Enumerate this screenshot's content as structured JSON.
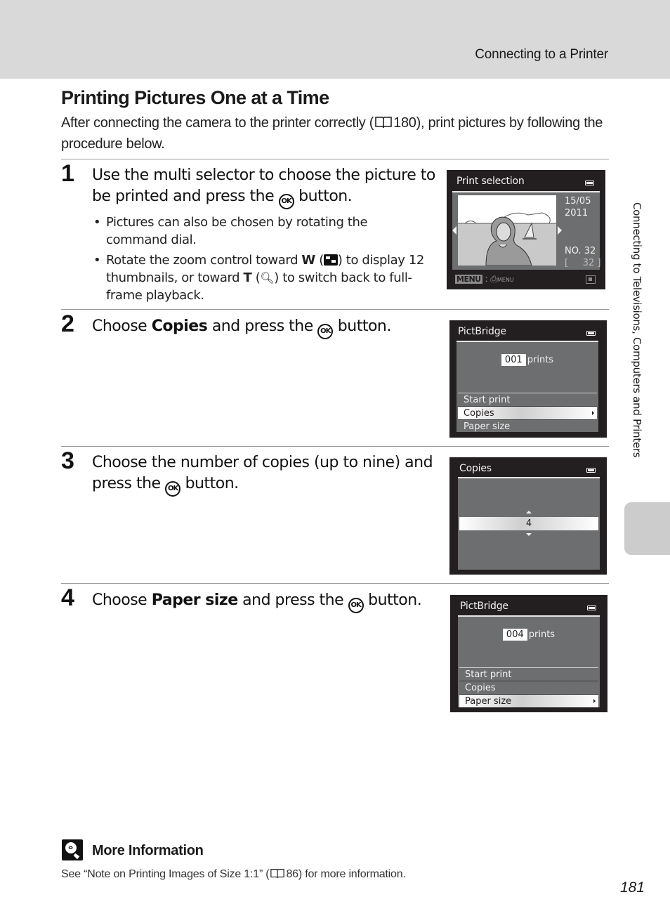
{
  "header": {
    "section_title": "Connecting to a Printer"
  },
  "page": {
    "title": "Printing Pictures One at a Time",
    "intro_before_ref": "After connecting the camera to the printer correctly (",
    "intro_ref": "180",
    "intro_after_ref": "), print pictures by following the procedure below.",
    "page_number": "181"
  },
  "icons": {
    "ok": "OK",
    "book": "book-icon",
    "zoom_w": "W",
    "zoom_t": "T"
  },
  "steps": [
    {
      "number": "1",
      "text_line": "Use the multi selector to choose the picture to be printed and press the",
      "text_end": "button.",
      "bullets": [
        {
          "text": "Pictures can also be chosen by rotating the command dial."
        },
        {
          "part1": "Rotate the zoom control toward",
          "w": "W",
          "part2": ") to display 12 thumbnails, or toward",
          "t": "T",
          "part3": ") to switch back to full-frame playback."
        }
      ],
      "screen": {
        "title": "Print selection",
        "date": "15/05",
        "year": "2011",
        "number": "NO. 32",
        "count": "[     32 ]",
        "footer_menu": "MENU",
        "footer_label": "MENU"
      }
    },
    {
      "number": "2",
      "pre": "Choose",
      "bold": "Copies",
      "post": "and press the",
      "end": "button.",
      "screen": {
        "title": "PictBridge",
        "prints_count": "001",
        "prints_label": "prints",
        "menu": [
          "Start print",
          "Copies",
          "Paper size"
        ],
        "selected_index": 1
      }
    },
    {
      "number": "3",
      "text": "Choose the number of copies (up to nine) and press the",
      "end": "button.",
      "screen": {
        "title": "Copies",
        "value": "4"
      }
    },
    {
      "number": "4",
      "pre": "Choose",
      "bold": "Paper size",
      "post": "and press the",
      "end": "button.",
      "screen": {
        "title": "PictBridge",
        "prints_count": "004",
        "prints_label": "prints",
        "menu": [
          "Start print",
          "Copies",
          "Paper size"
        ],
        "selected_index": 2
      }
    }
  ],
  "more_info": {
    "title": "More Information",
    "text_before": "See “Note on Printing Images of Size 1:1” (",
    "ref": "86",
    "text_after": ") for more information."
  },
  "side_tab": {
    "label": "Connecting to Televisions, Computers and Printers"
  }
}
